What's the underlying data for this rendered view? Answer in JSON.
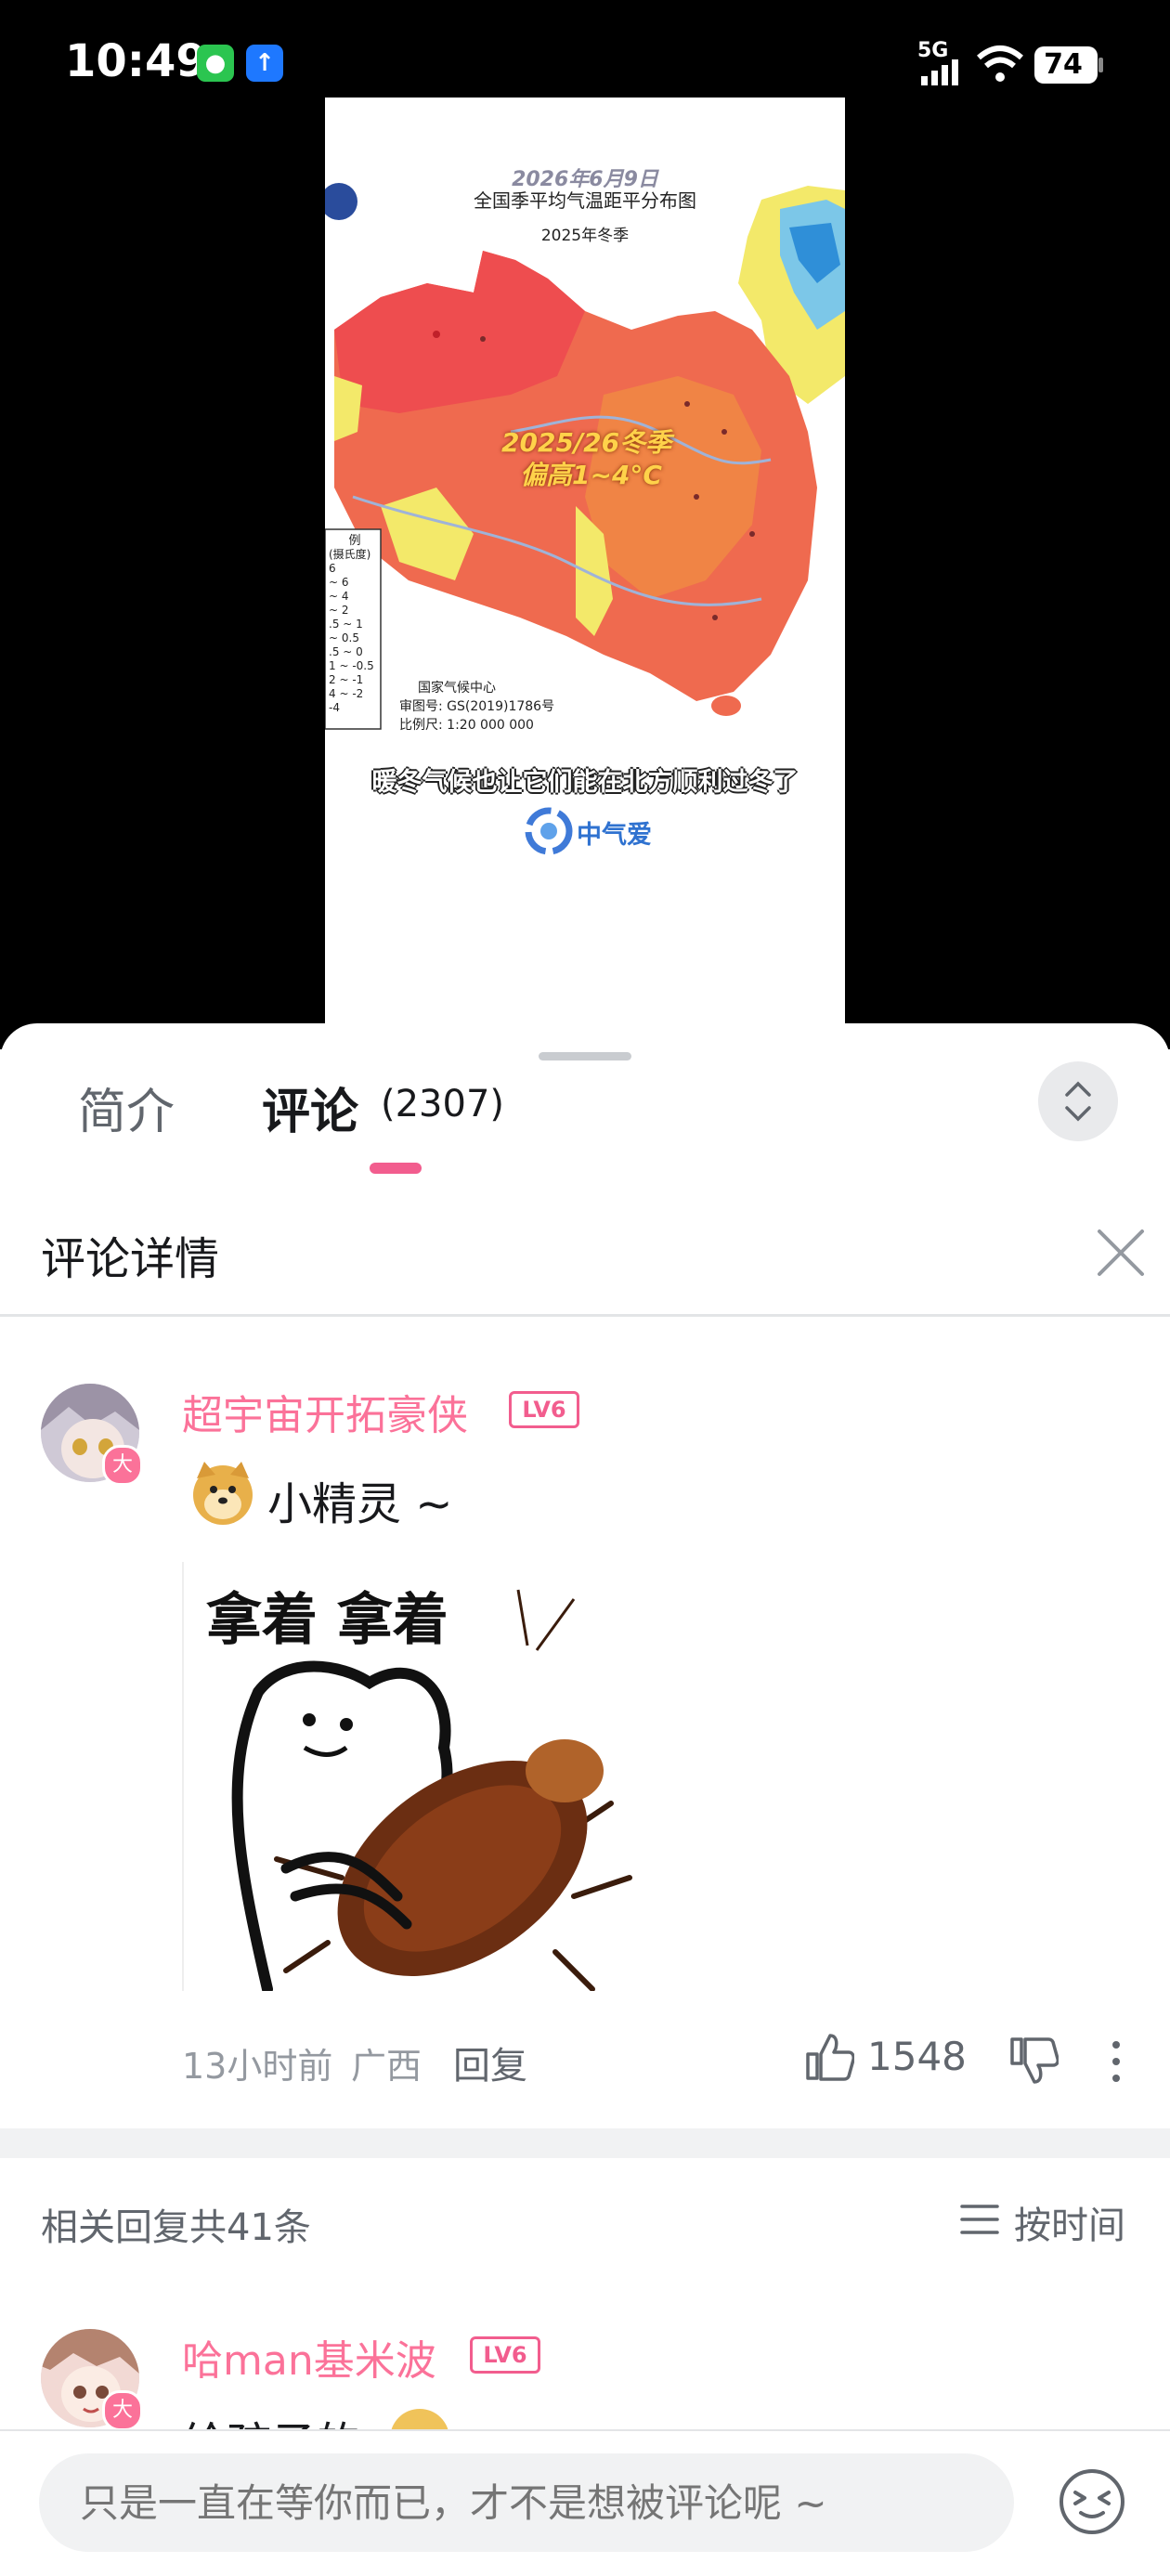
{
  "status_bar": {
    "time": "10:49",
    "network": "5G",
    "battery": "74"
  },
  "video": {
    "map_watermark_date": "2026年6月9日",
    "map_title": "全国季平均气温距平分布图",
    "map_subtitle": "2025年冬季",
    "map_callout_line1": "2025/26冬季",
    "map_callout_line2": "偏高1~4°C",
    "legend_title": "例",
    "legend_unit": "(摄氏度)",
    "legend_items": [
      "6",
      "~ 6",
      "~ 4",
      "~ 2",
      ".5 ~ 1",
      "~ 0.5",
      ".5 ~ 0",
      "1 ~ -0.5",
      "2 ~ -1",
      "4 ~ -2",
      "-4"
    ],
    "map_credit_1": "国家气候中心",
    "map_credit_2": "审图号: GS(2019)1786号",
    "map_credit_3": "比例尺: 1:20 000 000",
    "subtitle": "暖冬气候也让它们能在北方顺利过冬了",
    "logo_text": "中气爱"
  },
  "tabs": {
    "intro": "简介",
    "comments": "评论",
    "comments_count": "(2307)"
  },
  "detail": {
    "title": "评论详情"
  },
  "main_comment": {
    "username": "超宇宙开拓豪侠",
    "level": "LV6",
    "avatar_badge": "大",
    "text": "小精灵 ~",
    "sticker_text": "拿着 拿着",
    "time": "13小时前",
    "location": "广西",
    "reply_label": "回复",
    "likes": "1548"
  },
  "replies_header": {
    "count_text": "相关回复共41条",
    "sort_label": "按时间"
  },
  "reply_1": {
    "username": "哈man基米波",
    "level": "LV6",
    "avatar_badge": "大",
    "text": "给孩子的"
  },
  "input": {
    "placeholder": "只是一直在等你而已，才不是想被评论呢 ~"
  },
  "colors": {
    "accent": "#fb7299",
    "sheet_bg": "#ffffff",
    "muted": "#9499a0"
  }
}
